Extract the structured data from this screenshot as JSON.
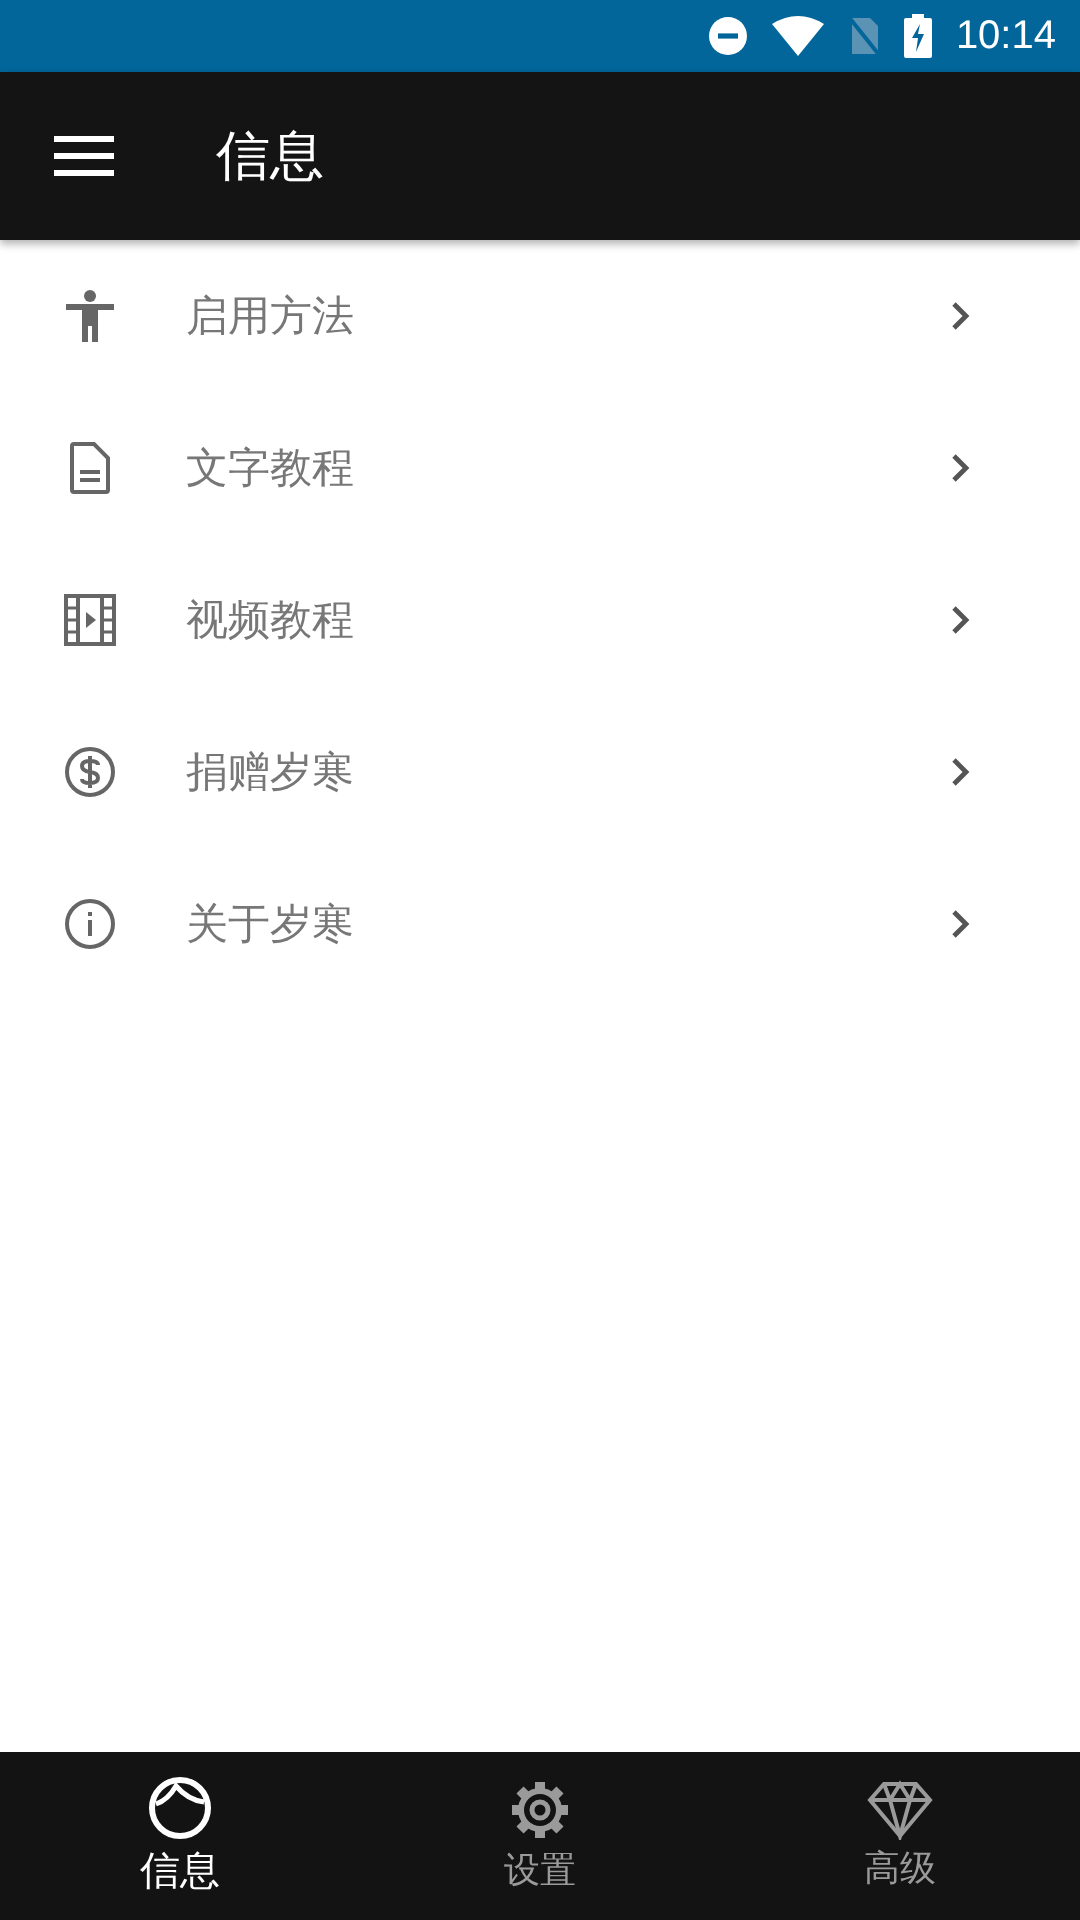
{
  "status_bar": {
    "time": "10:14"
  },
  "app_bar": {
    "title": "信息"
  },
  "menu_items": [
    {
      "kind": "accessibility",
      "label": "启用方法"
    },
    {
      "kind": "document",
      "label": "文字教程"
    },
    {
      "kind": "video",
      "label": "视频教程"
    },
    {
      "kind": "donate",
      "label": "捐赠岁寒"
    },
    {
      "kind": "info",
      "label": "关于岁寒"
    }
  ],
  "bottom_nav": [
    {
      "kind": "head",
      "label": "信息",
      "selected": true
    },
    {
      "kind": "gear",
      "label": "设置",
      "selected": false
    },
    {
      "kind": "diamond",
      "label": "高级",
      "selected": false
    }
  ]
}
